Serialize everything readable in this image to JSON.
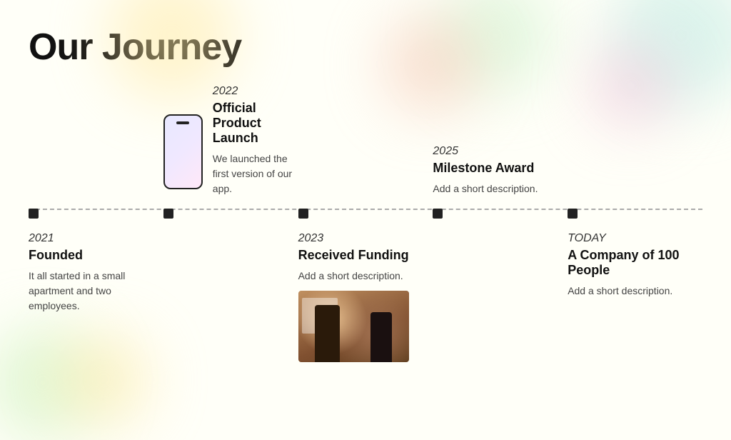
{
  "page": {
    "title": "Our Journey",
    "background": "#fffff8"
  },
  "timeline": {
    "milestones": [
      {
        "id": "founded",
        "position": "bottom",
        "year": "2021",
        "title": "Founded",
        "description": "It all started in a small apartment and two employees.",
        "has_image": false
      },
      {
        "id": "product-launch",
        "position": "top",
        "year": "2022",
        "title": "Official Product Launch",
        "description": "We launched the first version of our app.",
        "has_image": false,
        "has_phone": true
      },
      {
        "id": "received-funding",
        "position": "bottom",
        "year": "2023",
        "title": "Received Funding",
        "description": "Add a short description.",
        "has_image": true
      },
      {
        "id": "milestone-award",
        "position": "top",
        "year": "2025",
        "title": "Milestone Award",
        "description": "Add a short description.",
        "has_image": false
      },
      {
        "id": "company-100",
        "position": "bottom",
        "year": "TODAY",
        "title": "A Company of 100 People",
        "description": "Add a short description.",
        "has_image": false
      }
    ]
  }
}
